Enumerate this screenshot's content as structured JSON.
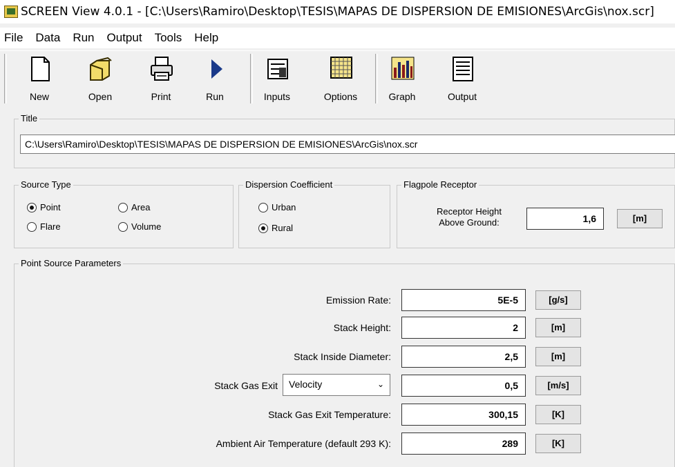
{
  "window": {
    "title": "SCREEN View 4.0.1 - [C:\\Users\\Ramiro\\Desktop\\TESIS\\MAPAS DE DISPERSION  DE EMISIONES\\ArcGis\\nox.scr]"
  },
  "menu": [
    "File",
    "Data",
    "Run",
    "Output",
    "Tools",
    "Help"
  ],
  "toolbar": {
    "new": "New",
    "open": "Open",
    "print": "Print",
    "run": "Run",
    "inputs": "Inputs",
    "options": "Options",
    "graph": "Graph",
    "output": "Output"
  },
  "title_group": {
    "label": "Title",
    "value": "C:\\Users\\Ramiro\\Desktop\\TESIS\\MAPAS DE DISPERSION  DE EMISIONES\\ArcGis\\nox.scr"
  },
  "source_type": {
    "label": "Source Type",
    "options": [
      "Point",
      "Area",
      "Flare",
      "Volume"
    ],
    "selected": "Point"
  },
  "dispersion": {
    "label": "Dispersion Coefficient",
    "options": [
      "Urban",
      "Rural"
    ],
    "selected": "Rural"
  },
  "flagpole": {
    "label": "Flagpole Receptor",
    "field_label_1": "Receptor Height",
    "field_label_2": "Above Ground:",
    "value": "1,6",
    "unit": "[m]"
  },
  "point_source": {
    "label": "Point Source Parameters",
    "rows": [
      {
        "label": "Emission Rate:",
        "value": "5E-5",
        "unit": "[g/s]"
      },
      {
        "label": "Stack Height:",
        "value": "2",
        "unit": "[m]"
      },
      {
        "label": "Stack Inside Diameter:",
        "value": "2,5",
        "unit": "[m]"
      },
      {
        "label": "Stack Gas Exit",
        "select": "Velocity",
        "value": "0,5",
        "unit": "[m/s]"
      },
      {
        "label": "Stack Gas Exit Temperature:",
        "value": "300,15",
        "unit": "[K]"
      },
      {
        "label": "Ambient Air Temperature (default 293 K):",
        "value": "289",
        "unit": "[K]"
      }
    ]
  },
  "colors": {
    "background": "#f0f0f0",
    "accent_run": "#1a3a8a"
  }
}
